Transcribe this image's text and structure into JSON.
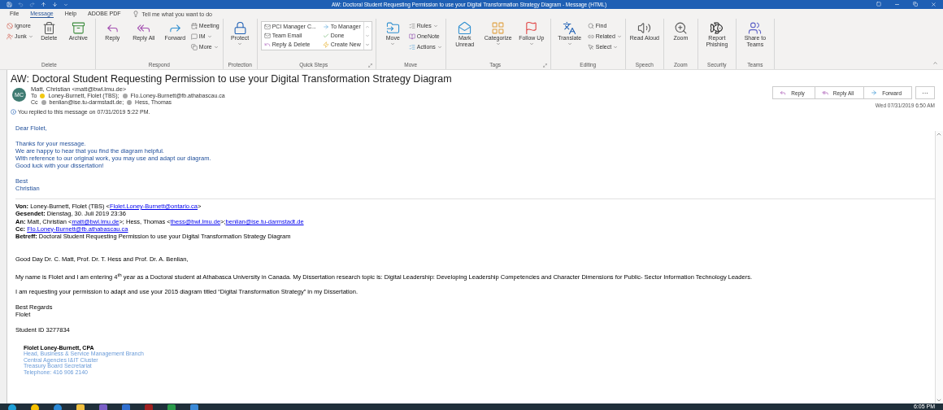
{
  "title_bar": {
    "title": "AW: Doctoral Student Requesting Permission to use your Digital Transformation Strategy Diagram  -  Message (HTML)"
  },
  "menu_tabs": [
    {
      "label": "File",
      "selected": false
    },
    {
      "label": "Message",
      "selected": true
    },
    {
      "label": "Help",
      "selected": false
    },
    {
      "label": "ADOBE PDF",
      "selected": false
    }
  ],
  "tell_me": {
    "placeholder": "Tell me what you want to do"
  },
  "ribbon": [
    {
      "label": "Delete",
      "launcher": false,
      "items": [
        {
          "kind": "small",
          "label": "Ignore",
          "menu": false
        },
        {
          "kind": "small",
          "label": "Junk",
          "menu": true
        },
        {
          "kind": "large",
          "label": "Delete",
          "menu": false
        },
        {
          "kind": "large",
          "label": "Archive",
          "menu": false
        }
      ]
    },
    {
      "label": "Respond",
      "launcher": false,
      "items": [
        {
          "kind": "large",
          "label": "Reply",
          "menu": false
        },
        {
          "kind": "large",
          "label": "Reply All",
          "menu": false
        },
        {
          "kind": "large",
          "label": "Forward",
          "menu": false
        },
        {
          "kind": "small",
          "label": "Meeting",
          "menu": false
        },
        {
          "kind": "small",
          "label": "IM",
          "menu": true
        },
        {
          "kind": "small",
          "label": "More",
          "menu": true
        }
      ]
    },
    {
      "label": "Protection",
      "launcher": false,
      "items": [
        {
          "kind": "large",
          "label": "Protect",
          "menu": true
        }
      ]
    },
    {
      "label": "Quick Steps",
      "launcher": true,
      "items": [
        {
          "kind": "gallery",
          "label": "PCI Manager C..."
        },
        {
          "kind": "gallery",
          "label": "Team Email"
        },
        {
          "kind": "gallery",
          "label": "Reply & Delete"
        },
        {
          "kind": "gallery",
          "label": "To Manager"
        },
        {
          "kind": "gallery",
          "label": "Done"
        },
        {
          "kind": "gallery",
          "label": "Create New"
        }
      ]
    },
    {
      "label": "Move",
      "launcher": false,
      "items": [
        {
          "kind": "large",
          "label": "Move",
          "menu": true
        },
        {
          "kind": "small",
          "label": "Rules",
          "menu": true
        },
        {
          "kind": "small",
          "label": "OneNote",
          "menu": false
        },
        {
          "kind": "small",
          "label": "Actions",
          "menu": true
        }
      ]
    },
    {
      "label": "Tags",
      "launcher": true,
      "items": [
        {
          "kind": "large",
          "label": "Mark Unread",
          "menu": false
        },
        {
          "kind": "large",
          "label": "Categorize",
          "menu": true
        },
        {
          "kind": "large",
          "label": "Follow Up",
          "menu": true
        }
      ]
    },
    {
      "label": "Editing",
      "launcher": false,
      "items": [
        {
          "kind": "large",
          "label": "Translate",
          "menu": true
        },
        {
          "kind": "small",
          "label": "Find",
          "menu": false
        },
        {
          "kind": "small",
          "label": "Related",
          "menu": true
        },
        {
          "kind": "small",
          "label": "Select",
          "menu": true
        }
      ]
    },
    {
      "label": "Speech",
      "launcher": false,
      "items": [
        {
          "kind": "large",
          "label": "Read Aloud",
          "menu": false
        }
      ]
    },
    {
      "label": "Zoom",
      "launcher": false,
      "items": [
        {
          "kind": "large",
          "label": "Zoom",
          "menu": false
        }
      ]
    },
    {
      "label": "Security",
      "launcher": false,
      "items": [
        {
          "kind": "large",
          "label": "Report Phishing",
          "menu": false
        }
      ]
    },
    {
      "label": "Teams",
      "launcher": false,
      "items": [
        {
          "kind": "large",
          "label": "Share to Teams",
          "menu": false
        }
      ]
    }
  ],
  "message": {
    "subject": "AW: Doctoral Student Requesting Permission to use your Digital Transformation Strategy Diagram",
    "avatar": "MC",
    "sender": "Matt, Christian <matt@bwl.lmu.de>",
    "to": {
      "label": "To",
      "recipients": [
        {
          "name": "Loney-Burnett, Flolet (TBS);",
          "color": "#f2c811"
        },
        {
          "name": "Flo.Loney-Burnett@fb.athabascau.ca",
          "color": "#a6a6a6"
        }
      ]
    },
    "cc": {
      "label": "Cc",
      "recipients": [
        {
          "name": "benlian@ise.tu-darmstadt.de;",
          "color": "#a6a6a6"
        },
        {
          "name": "Hess, Thomas",
          "color": "#a6a6a6"
        }
      ]
    },
    "info": "You replied to this message on 07/31/2019 5:22 PM.",
    "actions": [
      {
        "kind": "reply",
        "label": "Reply"
      },
      {
        "kind": "reply-all",
        "label": "Reply All"
      },
      {
        "kind": "forward",
        "label": "Forward"
      }
    ],
    "more": "···",
    "date": "Wed 07/31/2019 6:50 AM"
  },
  "body": {
    "reply": [
      [
        "Dear Flolet,"
      ],
      [
        "Thanks for your message.",
        "We are happy to hear that you find the diagram helpful.",
        "With reference to our original work, you may use and adapt our diagram.",
        "Good luck with your dissertation!"
      ],
      [
        "Best",
        "Christian"
      ]
    ],
    "quoted_header": [
      {
        "label": "Von:",
        "parts": [
          {
            "text": "Loney-Burnett, Flolet (TBS) <",
            "link": false
          },
          {
            "text": "Flolet.Loney-Burnett@ontario.ca",
            "link": true
          },
          {
            "text": ">",
            "link": false
          }
        ]
      },
      {
        "label": "Gesendet:",
        "parts": [
          {
            "text": "Dienstag, 30. Juli 2019 23:36",
            "link": false
          }
        ]
      },
      {
        "label": "An:",
        "parts": [
          {
            "text": "Matt, Christian <",
            "link": false
          },
          {
            "text": "matt@bwl.lmu.de",
            "link": true
          },
          {
            "text": ">; Hess, Thomas <",
            "link": false
          },
          {
            "text": "thess@bwl.lmu.de",
            "link": true
          },
          {
            "text": ">;",
            "link": false
          },
          {
            "text": "benlian@ise.tu-darmstadt.de",
            "link": true
          }
        ]
      },
      {
        "label": "Cc:",
        "parts": [
          {
            "text": "Flo.Loney-Burnett@fb.athabascau.ca",
            "link": true
          }
        ]
      },
      {
        "label": "Betreff:",
        "parts": [
          {
            "text": "Doctoral Student Requesting Permission to use your Digital Transformation Strategy Diagram",
            "link": false
          }
        ]
      }
    ],
    "quoted": [
      [
        "Good Day Dr. C. Matt, Prof. Dr. T. Hess and Prof. Dr. A. Benlian,"
      ],
      [
        "My name is Flolet and I am entering 4$^{th}$  year as a Doctoral student at Athabasca University in Canada. My Dissertation research topic is: Digital Leadership: Developing Leadership Competencies and Character Dimensions for Public- Sector Information Technology Leaders."
      ],
      [
        "I am requesting your permission to adapt and use your 2015 diagram titled “Digital Transformation Strategy” in my Dissertation."
      ],
      [
        "Best Regards",
        "Flolet"
      ],
      [
        "Student ID 3277834"
      ]
    ],
    "signature": {
      "name": "Flolet Loney-Burnett, CPA",
      "lines": [
        "Head, Business & Service Management Branch",
        "Central Agencies I&IT Cluster",
        "Treasury Board Secretariat",
        "Telephone: 416 906 2140"
      ]
    }
  },
  "taskbar": {
    "clock": "6:05 PM"
  }
}
